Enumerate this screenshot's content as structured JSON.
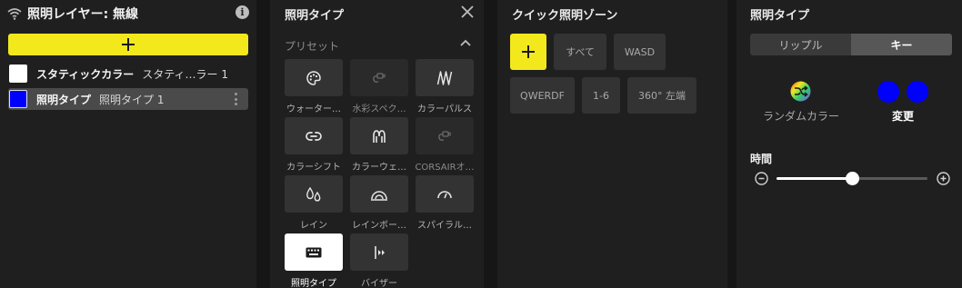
{
  "layers": {
    "title": "照明レイヤー: 無線",
    "items": [
      {
        "name": "スタティックカラー",
        "sub": "スタティ…ラー 1",
        "color": "#ffffff"
      },
      {
        "name": "照明タイプ",
        "sub": "照明タイプ 1",
        "color": "#0000ff"
      }
    ]
  },
  "lighting_type": {
    "title": "照明タイプ",
    "preset_label": "プリセット",
    "presets": [
      {
        "label": "ウォーター…",
        "icon": "palette-icon",
        "enabled": true
      },
      {
        "label": "水彩スペク…",
        "icon": "plug-icon",
        "enabled": false
      },
      {
        "label": "カラーパルス",
        "icon": "pulse-icon",
        "enabled": true
      },
      {
        "label": "カラーシフト",
        "icon": "link-icon",
        "enabled": true
      },
      {
        "label": "カラーウェ…",
        "icon": "wave-icon",
        "enabled": true
      },
      {
        "label": "CORSAIRオ…",
        "icon": "plug-icon",
        "enabled": false
      },
      {
        "label": "レイン",
        "icon": "rain-icon",
        "enabled": true
      },
      {
        "label": "レインボー…",
        "icon": "rainbow-icon",
        "enabled": true
      },
      {
        "label": "スパイラル…",
        "icon": "spiral-icon",
        "enabled": true
      },
      {
        "label": "照明タイプ",
        "icon": "keyboard-icon",
        "enabled": true,
        "selected": true
      },
      {
        "label": "バイザー",
        "icon": "visor-icon",
        "enabled": true
      }
    ]
  },
  "quick_zones": {
    "title": "クイック照明ゾーン",
    "buttons": [
      "すべて",
      "WASD",
      "QWERDF",
      "1-6",
      "360° 左端"
    ]
  },
  "lighting_opts": {
    "title": "照明タイプ",
    "tabs": [
      "リップル",
      "キー"
    ],
    "active_tab": "キー",
    "random_label": "ランダムカラー",
    "change_label": "変更",
    "colors": [
      "#0000ff",
      "#0000ff"
    ],
    "time_label": "時間",
    "time_value": 0.5
  },
  "colors": {
    "accent": "#f2e81c",
    "panel": "#1f1f1f",
    "tile": "#333333"
  }
}
